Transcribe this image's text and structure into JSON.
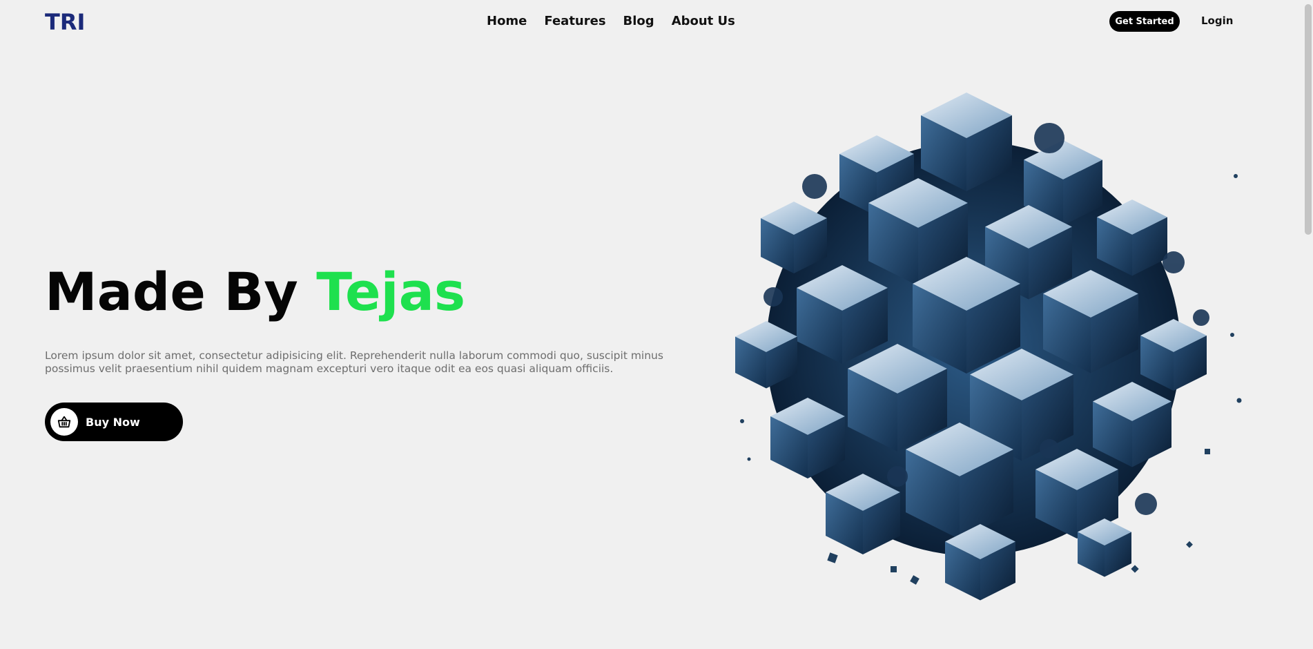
{
  "header": {
    "logo": "TRI",
    "nav": [
      "Home",
      "Features",
      "Blog",
      "About Us"
    ],
    "get_started": "Get Started",
    "login": "Login"
  },
  "hero": {
    "headline_main": "Made By ",
    "headline_accent": "Tejas",
    "description": "Lorem ipsum dolor sit amet, consectetur adipisicing elit. Reprehenderit nulla laborum commodi quo, suscipit minus possimus velit praesentium nihil quidem magnam excepturi vero itaque odit ea eos quasi aliquam officiis.",
    "buy_label": "Buy Now",
    "buy_icon": "shopping-basket-icon"
  },
  "colors": {
    "accent": "#1ee04e",
    "logo": "#1b2a7a",
    "button": "#000000",
    "background": "#f0f0f0",
    "art_primary": "#1d3f63"
  }
}
